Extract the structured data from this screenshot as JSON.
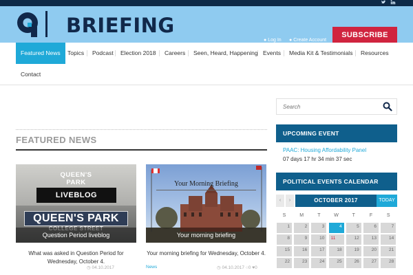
{
  "social": {
    "twitter_icon": "twitter-icon",
    "linkedin_icon": "linkedin-icon"
  },
  "brand": {
    "name": "BRIEFING",
    "logo_colors": {
      "navy": "#11284a",
      "accent": "#1fa9d8"
    }
  },
  "account": {
    "login": "Log In",
    "create": "Create Account"
  },
  "subscribe_label": "SUBSCRIBE",
  "nav": {
    "items": [
      "Featured News",
      "Topics",
      "Podcast",
      "Election 2018",
      "Careers",
      "Seen, Heard, Happening",
      "Events",
      "Media Kit & Testimonials",
      "Resources",
      "Contact"
    ],
    "active": "Featured News"
  },
  "search": {
    "placeholder": "Search"
  },
  "featured": {
    "heading": "FEATURED NEWS",
    "cards": [
      {
        "signs": [
          "QUEEN'S PARK",
          "LIVEBLOG",
          "QUEEN'S PARK",
          "COLLEGE STREET"
        ],
        "caption": "Question Period liveblog",
        "desc": "What was asked in Question Period for Wednesday, October 4.",
        "meta": "04.10.2017"
      },
      {
        "banner": "Your Morning Briefing",
        "caption": "Your morning briefing",
        "desc": "Your morning briefing for Wednesday, October 4.",
        "tag": "News",
        "meta": "04.10.2017",
        "comments": "0",
        "likes": "0"
      }
    ]
  },
  "sidebar": {
    "upcoming_heading": "UPCOMING EVENT",
    "event_title": "PAAC: Housing Affordability Panel",
    "countdown": "07 days 17 hr 34 min 37 sec",
    "calendar_heading": "POLITICAL EVENTS CALENDAR",
    "month": "OCTOBER 2017",
    "today_label": "TODAY",
    "weekdays": [
      "S",
      "M",
      "T",
      "W",
      "T",
      "F",
      "S"
    ],
    "weeks": [
      [
        "1",
        "2",
        "3",
        "4",
        "5",
        "6",
        "7"
      ],
      [
        "8",
        "9",
        "10",
        "11",
        "12",
        "13",
        "14"
      ],
      [
        "15",
        "16",
        "17",
        "18",
        "19",
        "20",
        "21"
      ],
      [
        "22",
        "23",
        "24",
        "25",
        "26",
        "27",
        "28"
      ]
    ],
    "today_day": "4",
    "event_day": "11"
  },
  "colors": {
    "header_bg": "#8fcbf0",
    "nav_active": "#1fa9d8",
    "subscribe": "#d0243f",
    "sidebar_head": "#0f5f8c"
  }
}
